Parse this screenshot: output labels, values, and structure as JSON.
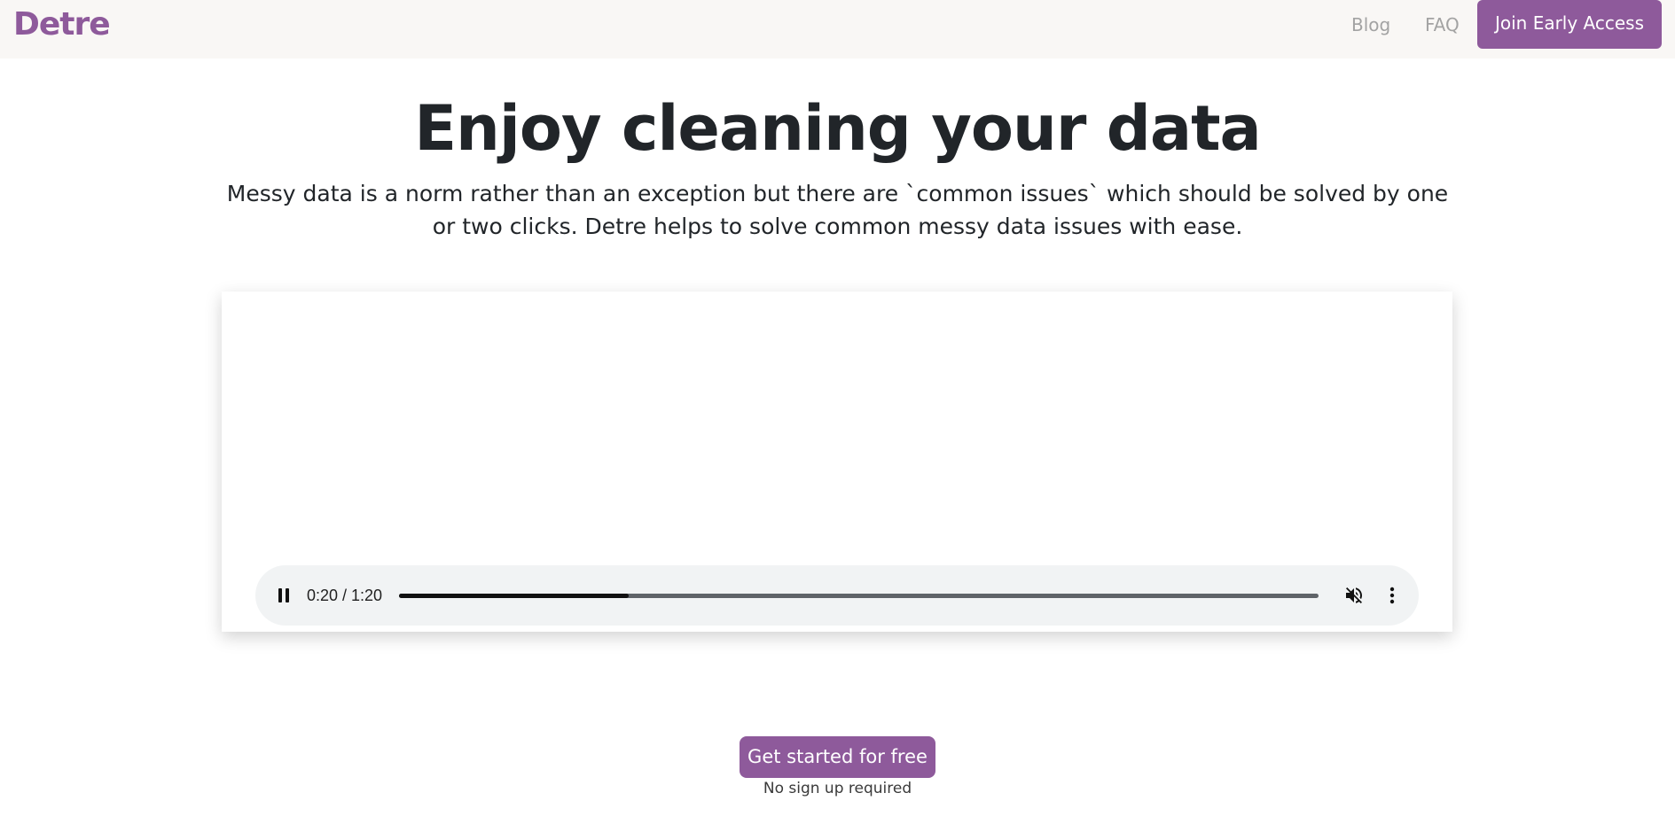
{
  "brand": {
    "name": "Detre",
    "color": "#8e5a9b"
  },
  "nav": {
    "links": [
      {
        "label": "Blog"
      },
      {
        "label": "FAQ"
      }
    ],
    "cta_label": "Join Early Access"
  },
  "hero": {
    "title": "Enjoy cleaning your data",
    "subtitle": "Messy data is a norm rather than an exception but there are `common issues` which should be solved by one or two clicks. Detre helps to solve common messy data issues with ease."
  },
  "video": {
    "time_display": "0:20 / 1:20",
    "progress": 0.25,
    "playing": true,
    "muted": true,
    "icons": [
      "pause-icon",
      "mute-icon",
      "more-vertical-icon"
    ]
  },
  "cta": {
    "label": "Get started for free",
    "note": "No sign up required"
  }
}
